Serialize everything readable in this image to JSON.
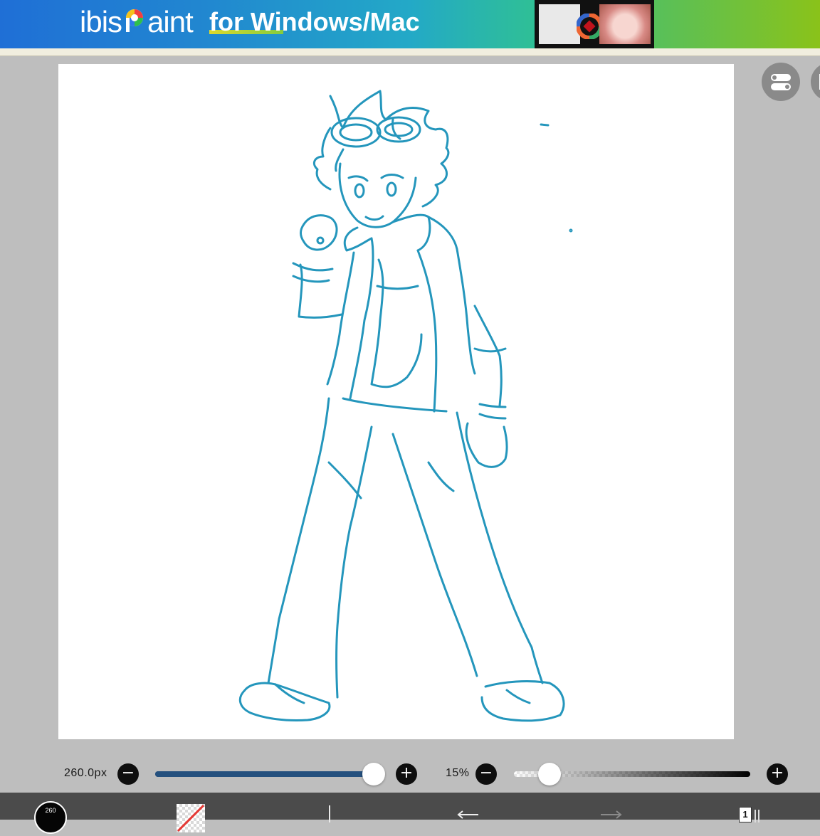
{
  "banner": {
    "logo_prefix": "ibis",
    "logo_suffix": "aint",
    "tagline": "for Windows/Mac"
  },
  "side_buttons": {
    "toggle_icon": "toggle-switches-icon",
    "more_icon": "more-icon"
  },
  "brush_size": {
    "label": "260.0px",
    "minus": "−",
    "plus": "+",
    "level": 0.96
  },
  "brush_opacity": {
    "label": "15%",
    "minus": "−",
    "plus": "+",
    "level": 0.15
  },
  "toolbar": {
    "brush_button_text": "260",
    "undo_icon": "undo-arrow-icon",
    "redo_icon": "redo-arrow-icon",
    "layer_count": "1"
  },
  "colors": {
    "line": "#2496bc",
    "canvas_bg": "#ffffff",
    "workspace_bg": "#bebebe",
    "toolbar_bg": "#4b4b4b"
  }
}
